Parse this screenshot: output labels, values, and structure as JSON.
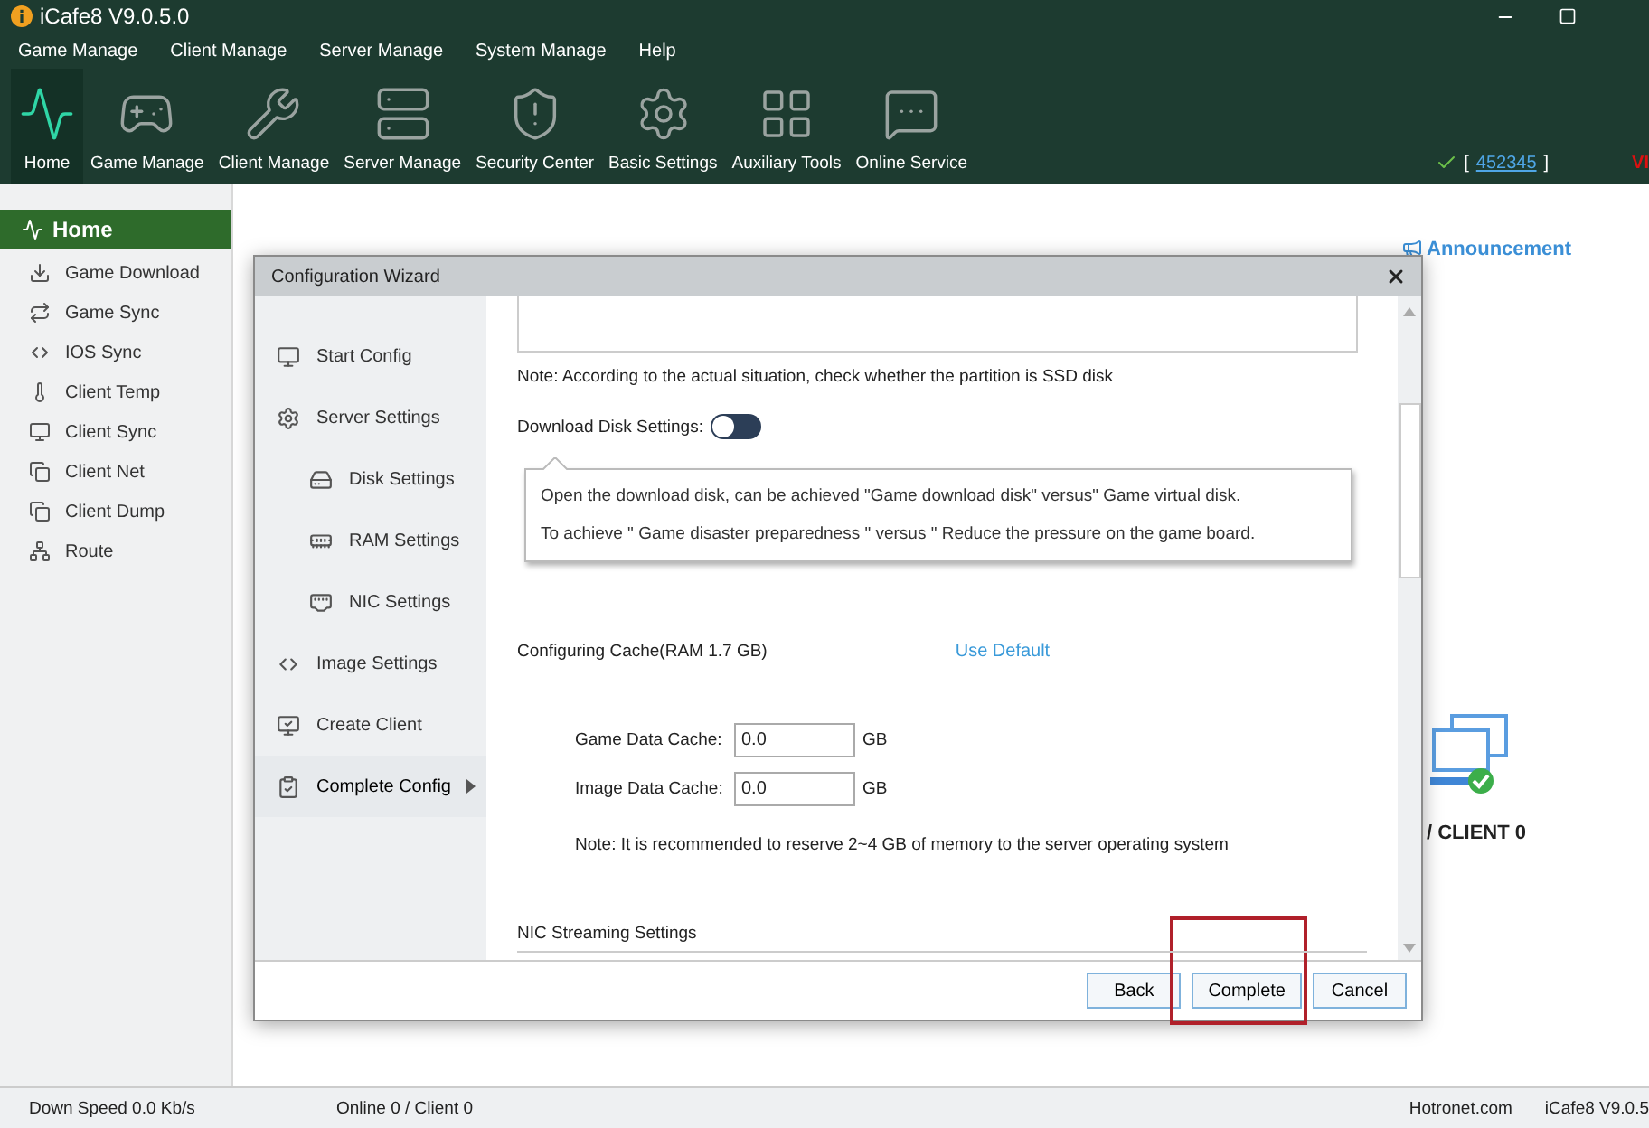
{
  "window": {
    "title": "iCafe8 V9.0.5.0"
  },
  "menu": [
    "Game Manage",
    "Client Manage",
    "Server Manage",
    "System Manage",
    "Help"
  ],
  "toolbar": [
    {
      "label": "Home",
      "selected": true
    },
    {
      "label": "Game Manage",
      "selected": false
    },
    {
      "label": "Client Manage",
      "selected": false
    },
    {
      "label": "Server Manage",
      "selected": false
    },
    {
      "label": "Security Center",
      "selected": false
    },
    {
      "label": "Basic Settings",
      "selected": false
    },
    {
      "label": "Auxiliary Tools",
      "selected": false
    },
    {
      "label": "Online Service",
      "selected": false
    }
  ],
  "account": {
    "open": "[",
    "id": "452345",
    "close": "]",
    "badge": "VI"
  },
  "sidebar": {
    "title": "Home",
    "items": [
      "Game Download",
      "Game Sync",
      "IOS Sync",
      "Client Temp",
      "Client Sync",
      "Client Net",
      "Client Dump",
      "Route"
    ]
  },
  "announcement": "Announcement",
  "client_status": "/ CLIENT 0",
  "dialog": {
    "title": "Configuration Wizard",
    "nav": [
      {
        "label": "Start Config",
        "selected": false
      },
      {
        "label": "Server Settings",
        "selected": false,
        "children": [
          {
            "label": "Disk Settings",
            "selected": false
          },
          {
            "label": "RAM Settings",
            "selected": false
          },
          {
            "label": "NIC Settings",
            "selected": false
          }
        ]
      },
      {
        "label": "Image Settings",
        "selected": false
      },
      {
        "label": "Create Client",
        "selected": false
      },
      {
        "label": "Complete Config",
        "selected": true
      }
    ],
    "ssd_note": "Note: According to the actual situation, check whether the partition is SSD disk",
    "toggle": {
      "label": "Download Disk Settings:",
      "on": false
    },
    "tooltip": [
      "Open the download disk, can be achieved \"Game download disk\" versus\" Game virtual disk.",
      "To achieve \" Game disaster preparedness \" versus \" Reduce the pressure on the game board."
    ],
    "cache": {
      "title": "Configuring Cache(RAM 1.7 GB)",
      "link": "Use Default",
      "fields": [
        {
          "label": "Game Data Cache:",
          "value": "0.0",
          "unit": "GB"
        },
        {
          "label": "Image Data Cache:",
          "value": "0.0",
          "unit": "GB"
        }
      ],
      "note": "Note: It is recommended to reserve 2~4 GB of memory to the server operating system"
    },
    "nic_title": "NIC Streaming Settings",
    "buttons": [
      {
        "label": "Back",
        "highlighted": false
      },
      {
        "label": "Complete",
        "highlighted": true
      },
      {
        "label": "Cancel",
        "highlighted": false
      }
    ]
  },
  "status_bar": {
    "down_speed": "Down Speed 0.0 Kb/s",
    "online": "Online 0 / Client 0",
    "site": "Hotronet.com",
    "version": "iCafe8 V9.0.5"
  }
}
